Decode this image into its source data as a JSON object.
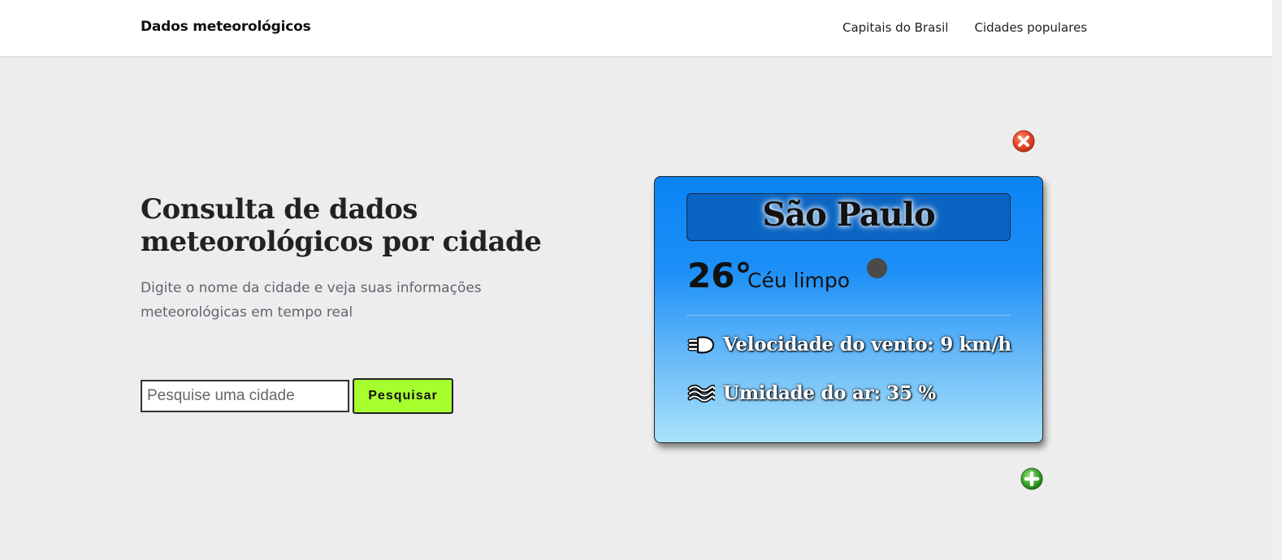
{
  "navbar": {
    "brand": "Dados meteorológicos",
    "links": [
      "Capitais do Brasil",
      "Cidades populares"
    ]
  },
  "hero": {
    "title": "Consulta de dados meteorológicos por cidade",
    "subtitle": "Digite o nome da cidade e veja suas informações meteorológicas em tempo real"
  },
  "search": {
    "placeholder": "Pesquise uma cidade",
    "value": "",
    "button_label": "Pesquisar"
  },
  "weather_card": {
    "city": "São Paulo",
    "temperature": "26°",
    "condition": "Céu limpo",
    "wind": "Velocidade do vento: 9 km/h",
    "humidity": "Umidade do ar: 35 %"
  },
  "icons": {
    "remove": "close-circle-icon",
    "add": "plus-circle-icon",
    "weather": "weather-condition-icon",
    "wind": "wind-icon",
    "humidity": "humidity-waves-icon"
  },
  "colors": {
    "search_button": "#a8ff2e",
    "card_top": "#0a84f5",
    "card_bottom": "#a9e3fb",
    "remove_icon": "#e8432a",
    "add_icon": "#3aa62c"
  }
}
